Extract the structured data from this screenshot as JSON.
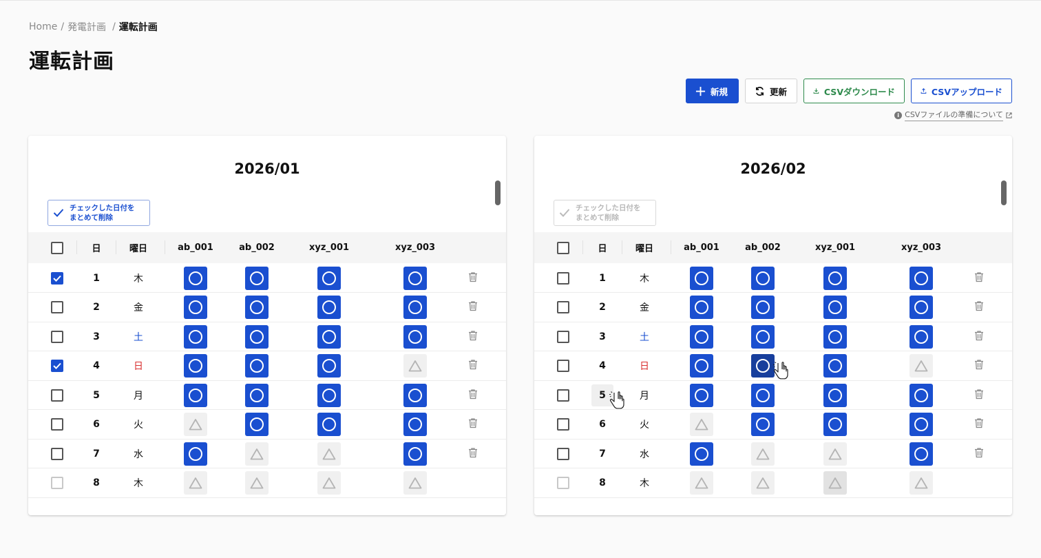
{
  "breadcrumb": {
    "home": "Home",
    "sep": "/",
    "parent": "発電計画",
    "current": "運転計画"
  },
  "page_title": "運転計画",
  "toolbar": {
    "new_label": "新規",
    "refresh_label": "更新",
    "download_label": "CSVダウンロード",
    "upload_label": "CSVアップロード"
  },
  "csv_help": {
    "text": "CSVファイルの準備について"
  },
  "colors": {
    "primary": "#1a4fd0",
    "success": "#2e8a4c",
    "saturday": "#1a4fd0",
    "sunday": "#d93030"
  },
  "table_headers": {
    "day": "日",
    "weekday": "曜日",
    "units": [
      "ab_001",
      "ab_002",
      "xyz_001",
      "xyz_003"
    ]
  },
  "bulk_delete": {
    "line1": "チェックした日付を",
    "line2": "まとめて削除"
  },
  "panels": [
    {
      "month": "2026/01",
      "bulk_enabled": true,
      "rows": [
        {
          "day": "1",
          "weekday": "木",
          "wd_type": "normal",
          "checked": true,
          "plans": [
            "on",
            "on",
            "on",
            "on"
          ],
          "deletable": true
        },
        {
          "day": "2",
          "weekday": "金",
          "wd_type": "normal",
          "checked": false,
          "plans": [
            "on",
            "on",
            "on",
            "on"
          ],
          "deletable": true
        },
        {
          "day": "3",
          "weekday": "土",
          "wd_type": "sat",
          "checked": false,
          "plans": [
            "on",
            "on",
            "on",
            "on"
          ],
          "deletable": true
        },
        {
          "day": "4",
          "weekday": "日",
          "wd_type": "sun",
          "checked": true,
          "plans": [
            "on",
            "on",
            "on",
            "off"
          ],
          "deletable": true
        },
        {
          "day": "5",
          "weekday": "月",
          "wd_type": "normal",
          "checked": false,
          "plans": [
            "on",
            "on",
            "on",
            "on"
          ],
          "deletable": true
        },
        {
          "day": "6",
          "weekday": "火",
          "wd_type": "normal",
          "checked": false,
          "plans": [
            "off",
            "on",
            "on",
            "on"
          ],
          "deletable": true
        },
        {
          "day": "7",
          "weekday": "水",
          "wd_type": "normal",
          "checked": false,
          "plans": [
            "on",
            "off",
            "off",
            "on"
          ],
          "deletable": true
        },
        {
          "day": "8",
          "weekday": "木",
          "wd_type": "normal",
          "checked": false,
          "disabled": true,
          "plans": [
            "off",
            "off",
            "off",
            "off"
          ],
          "deletable": false
        }
      ]
    },
    {
      "month": "2026/02",
      "bulk_enabled": false,
      "rows": [
        {
          "day": "1",
          "weekday": "木",
          "wd_type": "normal",
          "checked": false,
          "plans": [
            "on",
            "on",
            "on",
            "on"
          ],
          "deletable": true
        },
        {
          "day": "2",
          "weekday": "金",
          "wd_type": "normal",
          "checked": false,
          "plans": [
            "on",
            "on",
            "on",
            "on"
          ],
          "deletable": true
        },
        {
          "day": "3",
          "weekday": "土",
          "wd_type": "sat",
          "checked": false,
          "plans": [
            "on",
            "on",
            "on",
            "on"
          ],
          "deletable": true
        },
        {
          "day": "4",
          "weekday": "日",
          "wd_type": "sun",
          "checked": false,
          "plans": [
            "on",
            "on-hover",
            "on",
            "off"
          ],
          "deletable": true
        },
        {
          "day": "5",
          "weekday": "月",
          "wd_type": "normal",
          "checked": false,
          "day_hover": true,
          "plans": [
            "on",
            "on",
            "on",
            "on"
          ],
          "deletable": true
        },
        {
          "day": "6",
          "weekday": "火",
          "wd_type": "normal",
          "checked": false,
          "plans": [
            "off",
            "on",
            "on",
            "on"
          ],
          "deletable": true
        },
        {
          "day": "7",
          "weekday": "水",
          "wd_type": "normal",
          "checked": false,
          "plans": [
            "on",
            "off",
            "off",
            "on"
          ],
          "deletable": true
        },
        {
          "day": "8",
          "weekday": "木",
          "wd_type": "normal",
          "checked": false,
          "disabled": true,
          "plans": [
            "off",
            "off",
            "off-hover",
            "off"
          ],
          "deletable": false
        }
      ]
    }
  ]
}
